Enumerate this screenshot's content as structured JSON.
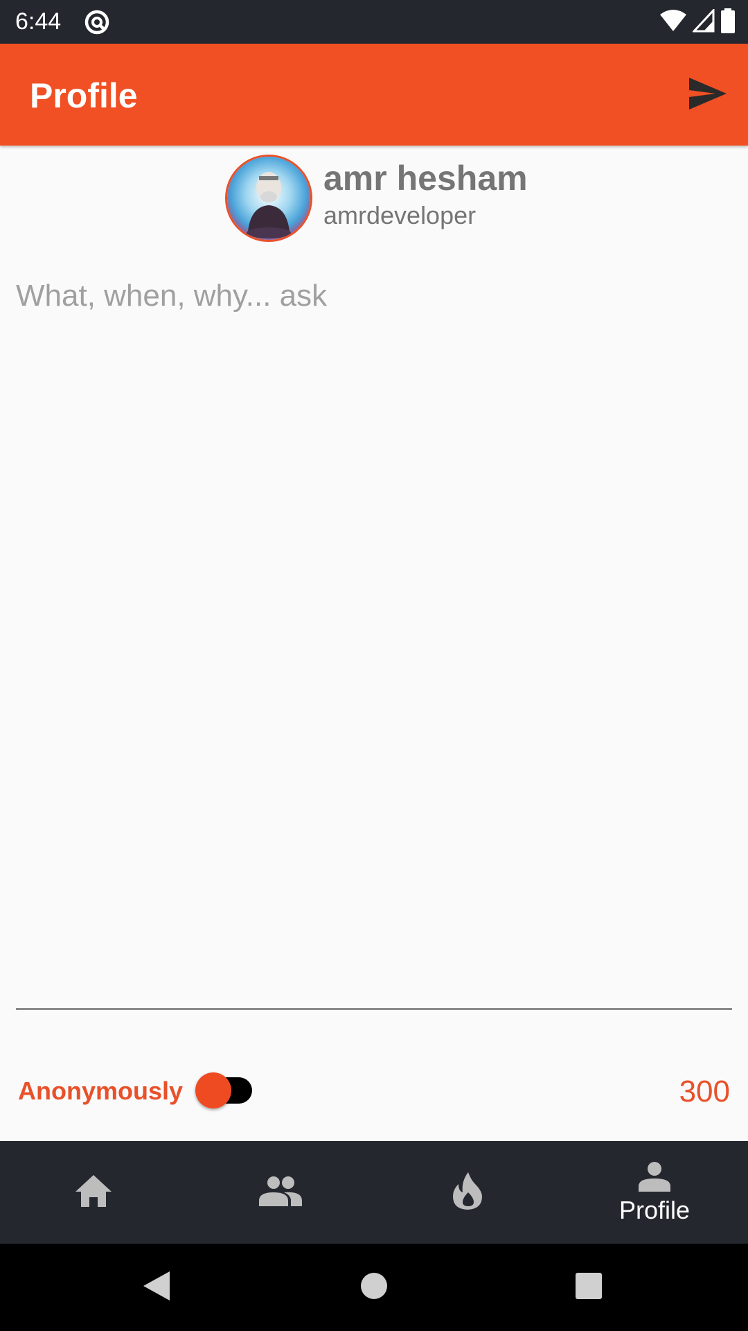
{
  "status_bar": {
    "time": "6:44",
    "icons": [
      "at-notification-icon",
      "wifi-icon",
      "signal-icon",
      "battery-icon"
    ]
  },
  "app_bar": {
    "title": "Profile",
    "action_icon": "send-icon"
  },
  "profile": {
    "name": "amr hesham",
    "username": "amrdeveloper",
    "avatar_icon": "avatar-image"
  },
  "question": {
    "placeholder": "What, when, why... ask",
    "value": ""
  },
  "options": {
    "anonymous_label": "Anonymously",
    "anonymous_enabled": false,
    "char_counter": "300"
  },
  "bottom_nav": {
    "items": [
      {
        "icon": "home-icon",
        "label": ""
      },
      {
        "icon": "people-icon",
        "label": ""
      },
      {
        "icon": "fire-icon",
        "label": ""
      },
      {
        "icon": "person-icon",
        "label": "Profile"
      }
    ],
    "active_index": 3
  },
  "system_nav": {
    "icons": [
      "back-icon",
      "home-circle-icon",
      "recents-icon"
    ]
  },
  "colors": {
    "accent": "#f05024",
    "dark_bar": "#24272e",
    "background": "#fafafa",
    "text_secondary": "#757575",
    "hint": "#a0a0a0"
  }
}
